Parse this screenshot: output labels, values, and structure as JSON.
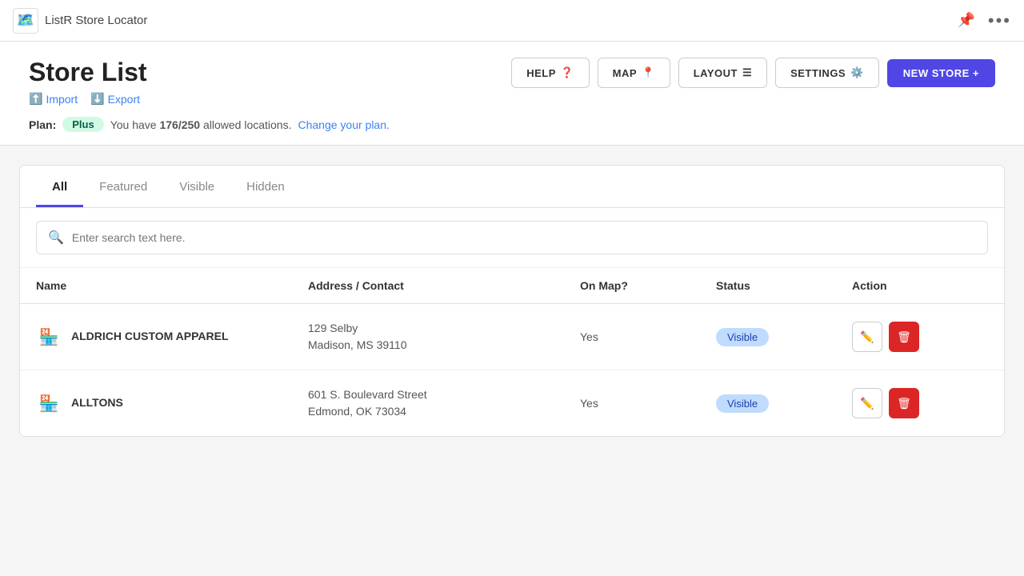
{
  "app": {
    "logo": "🗺️",
    "title": "ListR Store Locator"
  },
  "topbar": {
    "pin_icon": "📌",
    "more_icon": "•••"
  },
  "header": {
    "title": "Store List",
    "import_label": "Import",
    "export_label": "Export",
    "buttons": {
      "help": "HELP",
      "map": "MAP",
      "layout": "LAYOUT",
      "settings": "SETTINGS",
      "new_store": "NEW STORE +"
    }
  },
  "plan": {
    "label": "Plan:",
    "badge": "Plus",
    "description": "You have",
    "count": "176/250",
    "suffix": "allowed locations.",
    "change_link": "Change your plan."
  },
  "tabs": [
    {
      "id": "all",
      "label": "All",
      "active": true
    },
    {
      "id": "featured",
      "label": "Featured",
      "active": false
    },
    {
      "id": "visible",
      "label": "Visible",
      "active": false
    },
    {
      "id": "hidden",
      "label": "Hidden",
      "active": false
    }
  ],
  "search": {
    "placeholder": "Enter search text here."
  },
  "table": {
    "headers": {
      "name": "Name",
      "address": "Address / Contact",
      "on_map": "On Map?",
      "status": "Status",
      "action": "Action"
    },
    "rows": [
      {
        "name": "ALDRICH CUSTOM APPAREL",
        "address_line1": "129 Selby",
        "address_line2": "Madison, MS 39110",
        "on_map": "Yes",
        "status": "Visible"
      },
      {
        "name": "ALLTONS",
        "address_line1": "601 S. Boulevard Street",
        "address_line2": "Edmond, OK 73034",
        "on_map": "Yes",
        "status": "Visible"
      }
    ]
  }
}
